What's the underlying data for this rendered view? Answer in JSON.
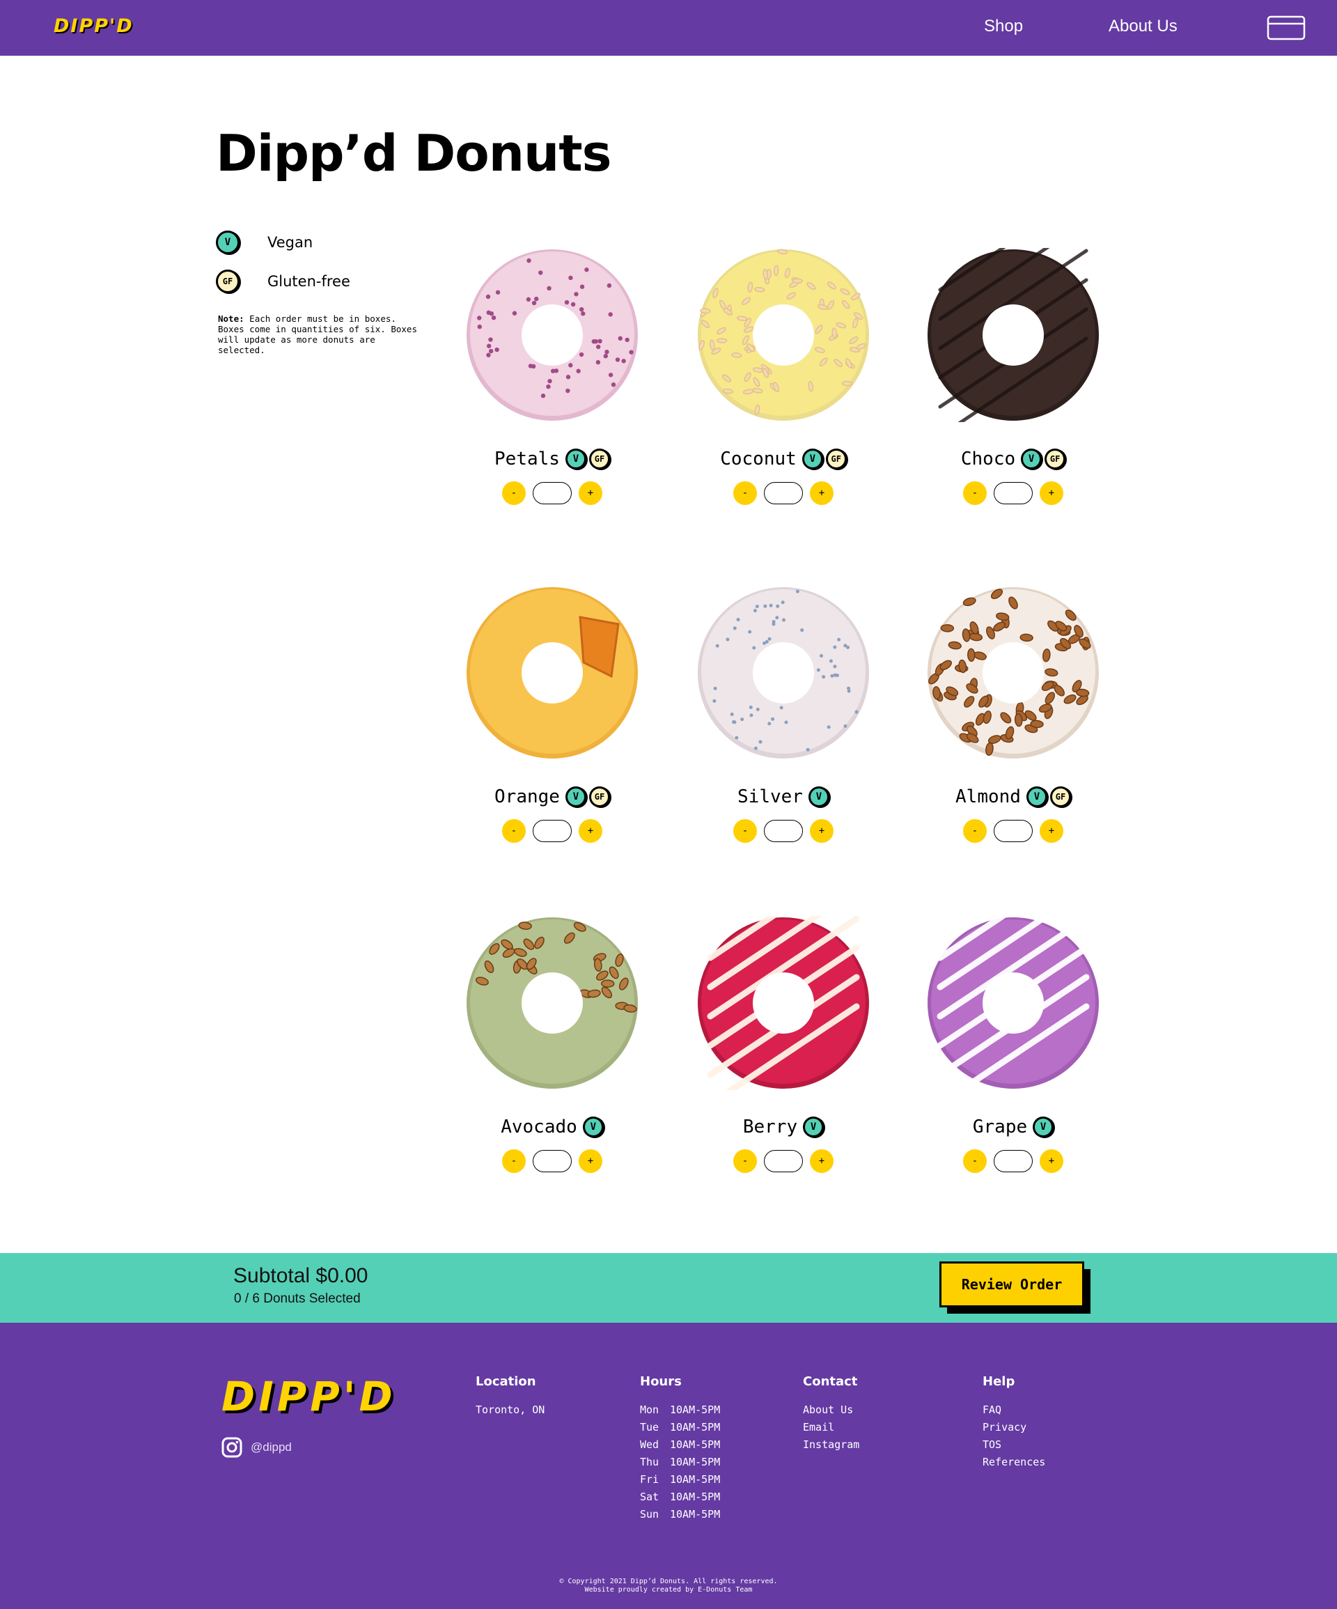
{
  "nav": {
    "logo": "DIPP'D",
    "links": [
      "Shop",
      "About Us"
    ],
    "cart_icon": "cart-box-icon"
  },
  "page_title": "Dipp’d Donuts",
  "legend": {
    "vegan": {
      "badge": "V",
      "label": "Vegan"
    },
    "gluten_free": {
      "badge": "GF",
      "label": "Gluten-free"
    }
  },
  "note": {
    "label": "Note:",
    "text": "Each order must be in boxes. Boxes come in quantities of six. Boxes will update as more donuts are selected."
  },
  "qty_controls": {
    "minus": "-",
    "plus": "+"
  },
  "donuts": [
    {
      "name": "Petals",
      "vegan": true,
      "gluten_free": true,
      "quantity": ""
    },
    {
      "name": "Coconut",
      "vegan": true,
      "gluten_free": true,
      "quantity": ""
    },
    {
      "name": "Choco",
      "vegan": true,
      "gluten_free": true,
      "quantity": ""
    },
    {
      "name": "Orange",
      "vegan": true,
      "gluten_free": true,
      "quantity": ""
    },
    {
      "name": "Silver",
      "vegan": true,
      "gluten_free": false,
      "quantity": ""
    },
    {
      "name": "Almond",
      "vegan": true,
      "gluten_free": true,
      "quantity": ""
    },
    {
      "name": "Avocado",
      "vegan": true,
      "gluten_free": false,
      "quantity": ""
    },
    {
      "name": "Berry",
      "vegan": true,
      "gluten_free": false,
      "quantity": ""
    },
    {
      "name": "Grape",
      "vegan": true,
      "gluten_free": false,
      "quantity": ""
    }
  ],
  "subtotal": {
    "label": "Subtotal $0.00",
    "selected": "0 / 6 Donuts Selected",
    "button": "Review Order"
  },
  "footer": {
    "logo": "DIPP'D",
    "instagram": {
      "icon": "instagram-icon",
      "handle": "@dippd"
    },
    "location": {
      "heading": "Location",
      "items": [
        "Toronto, ON"
      ]
    },
    "hours": {
      "heading": "Hours",
      "rows": [
        {
          "day": "Mon",
          "time": "10AM-5PM"
        },
        {
          "day": "Tue",
          "time": "10AM-5PM"
        },
        {
          "day": "Wed",
          "time": "10AM-5PM"
        },
        {
          "day": "Thu",
          "time": "10AM-5PM"
        },
        {
          "day": "Fri",
          "time": "10AM-5PM"
        },
        {
          "day": "Sat",
          "time": "10AM-5PM"
        },
        {
          "day": "Sun",
          "time": "10AM-5PM"
        }
      ]
    },
    "contact": {
      "heading": "Contact",
      "items": [
        "About Us",
        "Email",
        "Instagram"
      ]
    },
    "help": {
      "heading": "Help",
      "items": [
        "FAQ",
        "Privacy",
        "TOS",
        "References"
      ]
    },
    "copyright": "© Copyright 2021 Dipp’d Donuts. All rights reserved.",
    "credit": "Website proudly created by E-Donuts Team"
  },
  "colors": {
    "brand_purple": "#653aa3",
    "brand_yellow": "#ffd400",
    "teal": "#54d0b6",
    "gf_cream": "#fdf3c2"
  }
}
